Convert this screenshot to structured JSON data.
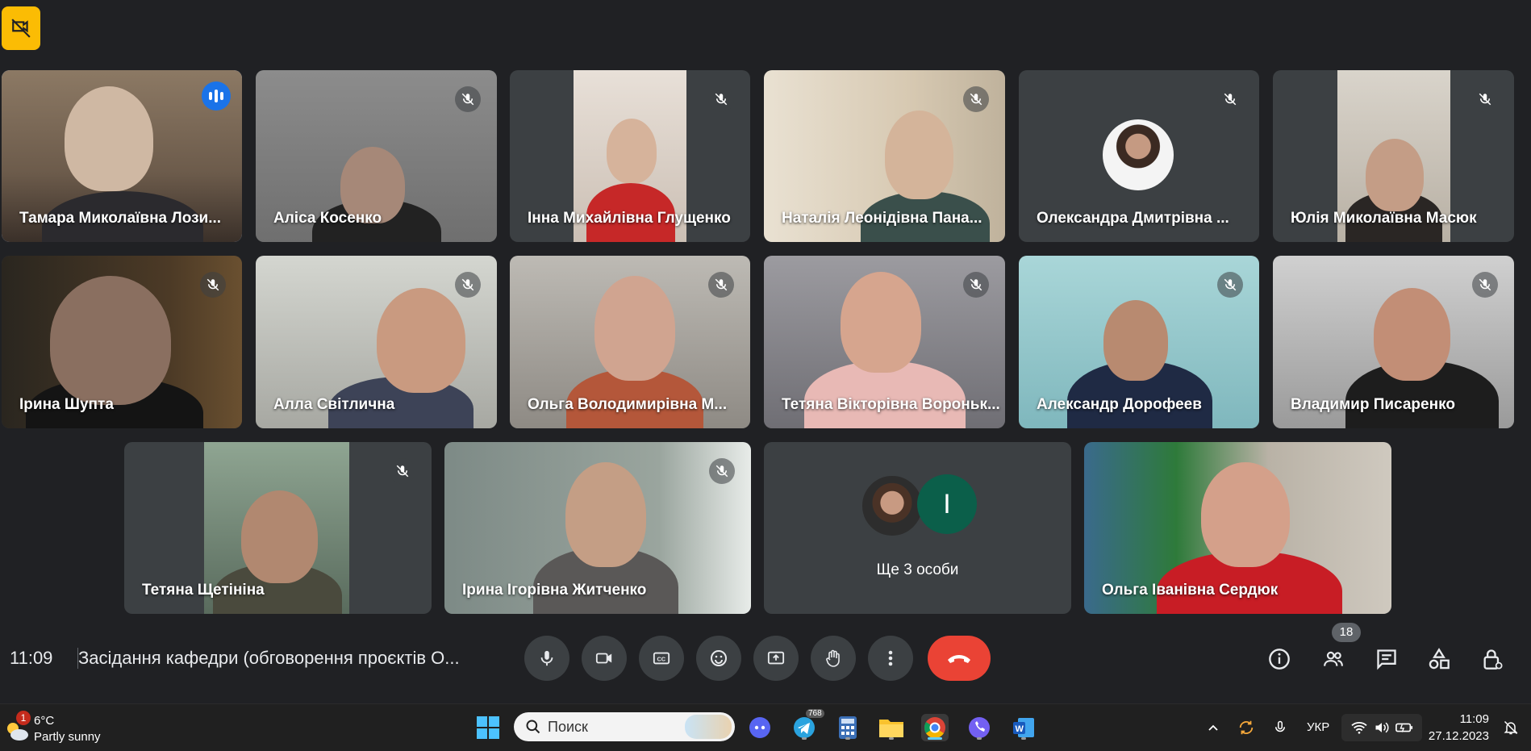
{
  "meeting": {
    "time": "11:09",
    "title": "Засідання кафедри (обговорення проєктів О...",
    "participant_count": "18"
  },
  "participants": [
    {
      "name": "Тамара Миколаївна Лози...",
      "speaking": true
    },
    {
      "name": "Аліса Косенко",
      "muted": true
    },
    {
      "name": "Інна Михайлівна Глущенко",
      "muted": true
    },
    {
      "name": "Наталія Леонідівна Пана...",
      "muted": true
    },
    {
      "name": "Олександра Дмитрівна ...",
      "muted": true
    },
    {
      "name": "Юлія Миколаївна Масюк",
      "muted": true
    },
    {
      "name": "Ірина Шупта",
      "muted": true
    },
    {
      "name": "Алла Світлична",
      "muted": true
    },
    {
      "name": "Ольга Володимирівна М...",
      "muted": true
    },
    {
      "name": "Тетяна Вікторівна Вороньк...",
      "muted": true
    },
    {
      "name": "Александр Дорофеев",
      "muted": true
    },
    {
      "name": "Владимир Писаренко",
      "muted": true
    },
    {
      "name": "Тетяна Щетініна",
      "muted": true
    },
    {
      "name": "Ірина Ігорівна Житченко",
      "muted": true
    },
    {
      "name": "Ольга Іванівна Сердюк",
      "muted": false
    }
  ],
  "more_people": {
    "label": "Ще 3 особи",
    "initial": "І"
  },
  "controls": {
    "mic": "microphone-icon",
    "camera": "camera-icon",
    "captions": "captions-icon",
    "reactions": "emoji-icon",
    "present": "present-screen-icon",
    "raise_hand": "hand-icon",
    "more": "more-options-icon",
    "leave": "end-call-icon"
  },
  "right_controls": [
    "info-icon",
    "people-icon",
    "chat-icon",
    "activities-icon",
    "host-controls-icon"
  ],
  "taskbar": {
    "weather_temp": "6°C",
    "weather_desc": "Partly sunny",
    "weather_badge": "1",
    "search_placeholder": "Поиск",
    "telegram_badge": "768",
    "language": "УКР",
    "clock_time": "11:09",
    "clock_date": "27.12.2023"
  },
  "colors": {
    "background": "#202124",
    "tile": "#3c4043",
    "accent_blue": "#1a73e8",
    "active_border": "#8ab4f8",
    "end_call": "#ea4335",
    "badge_yellow": "#fbbc04"
  }
}
